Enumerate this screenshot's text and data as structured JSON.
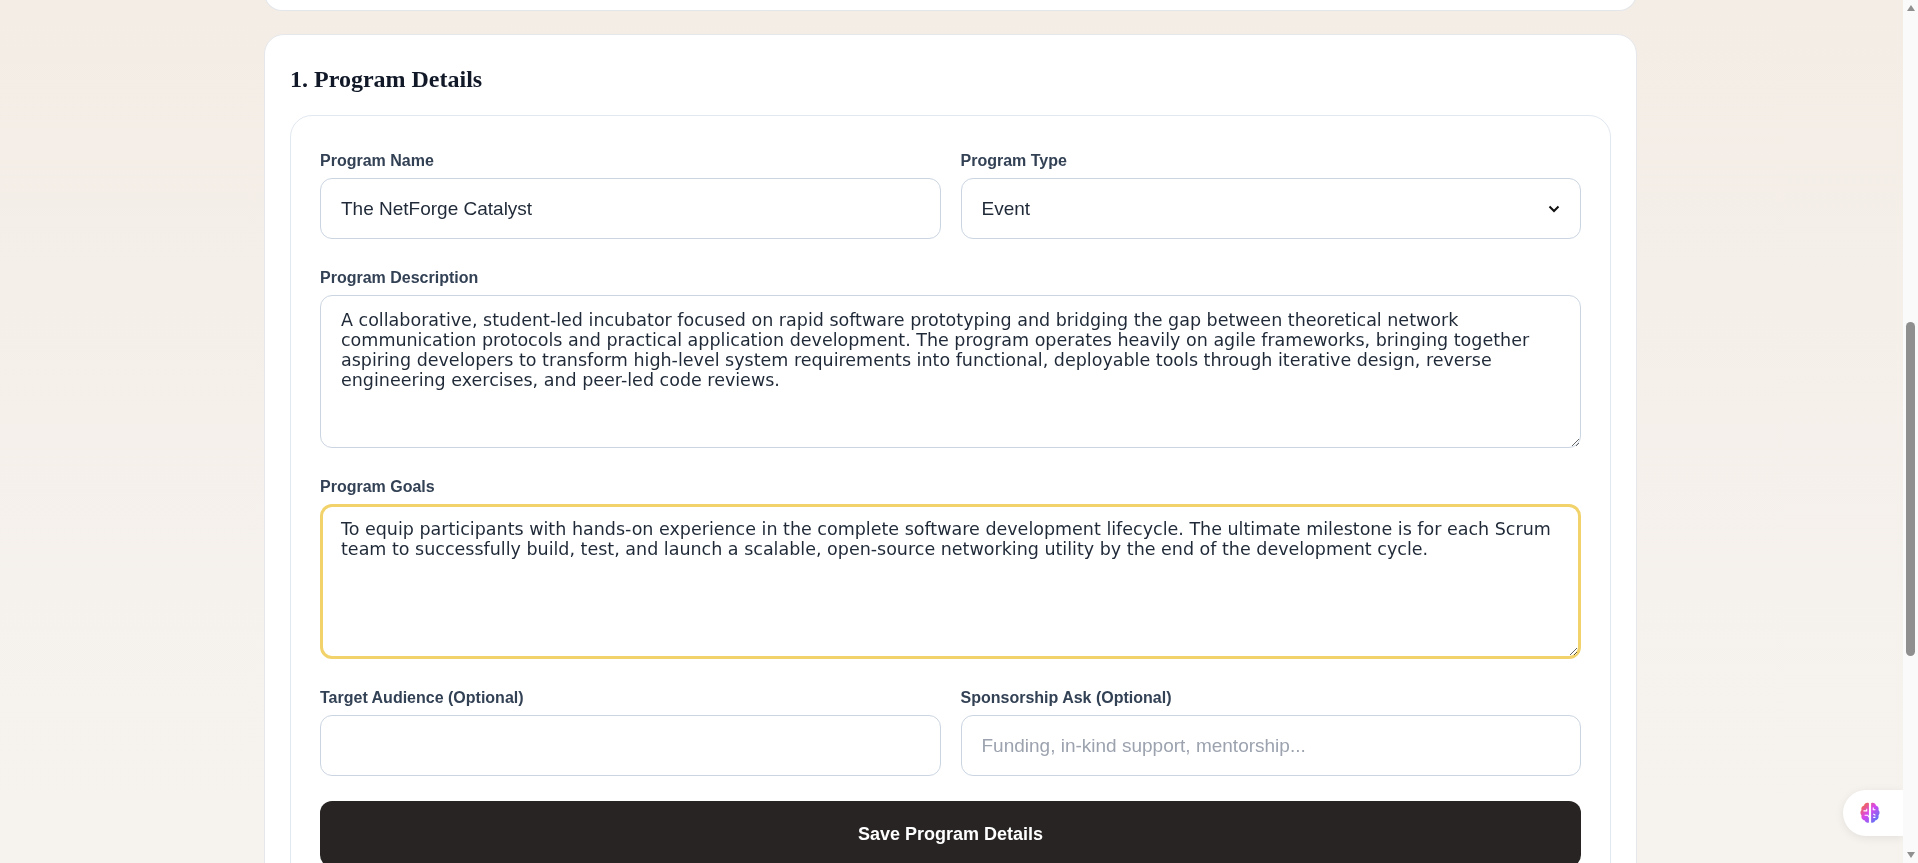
{
  "section": {
    "title": "1. Program Details"
  },
  "fields": [
    {
      "kind": "input",
      "label": "Program Name",
      "value": "The NetForge Catalyst",
      "focused": false
    },
    {
      "kind": "select",
      "label": "Program Type",
      "value": "Event",
      "focused": false
    },
    {
      "kind": "textarea",
      "label": "Program Description",
      "value": "A collaborative, student-led incubator focused on rapid software prototyping and bridging the gap between theoretical network communication protocols and practical application development. The program operates heavily on agile frameworks, bringing together aspiring developers to transform high-level system requirements into functional, deployable tools through iterative design, reverse engineering exercises, and peer-led code reviews.",
      "focused": false
    },
    {
      "kind": "textarea",
      "label": "Program Goals",
      "value": "To equip participants with hands-on experience in the complete software development lifecycle. The ultimate milestone is for each Scrum team to successfully build, test, and launch a scalable, open-source networking utility by the end of the development cycle.",
      "focused": true
    },
    {
      "kind": "input",
      "label": "Target Audience (Optional)",
      "focused": false
    },
    {
      "kind": "input",
      "label": "Sponsorship Ask (Optional)",
      "placeholder": "Funding, in-kind support, mentorship...",
      "focused": false
    }
  ],
  "save_button": {
    "label": "Save Program Details"
  }
}
